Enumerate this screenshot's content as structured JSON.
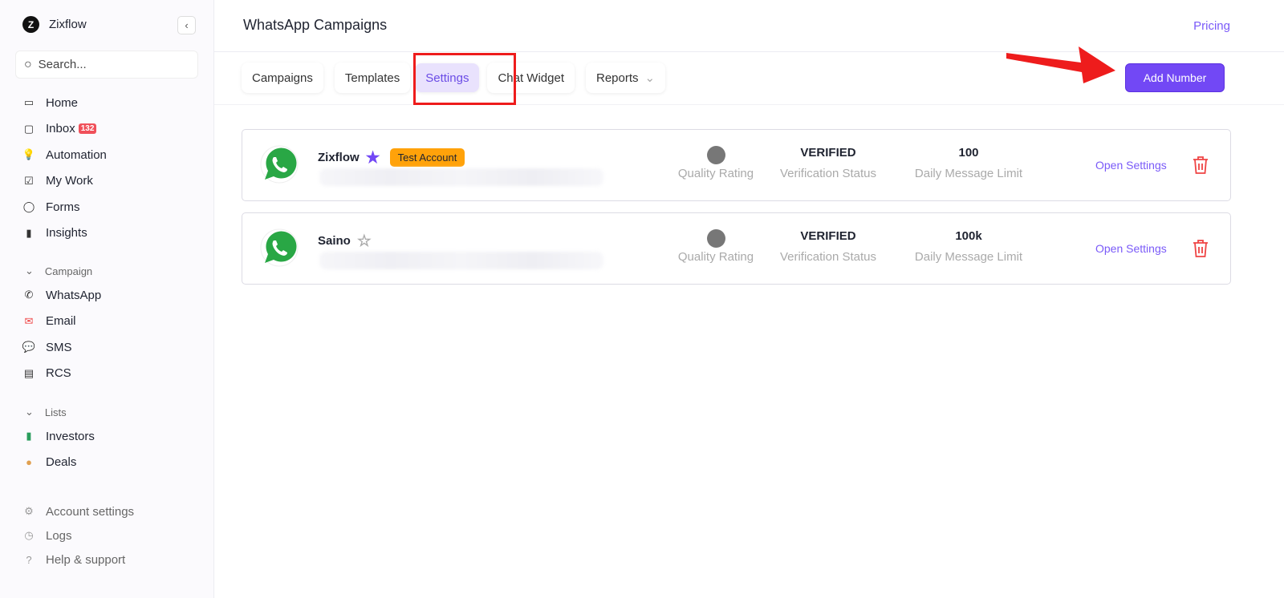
{
  "sidebar": {
    "brand": "Zixflow",
    "search_placeholder": "Search...",
    "items": [
      {
        "label": "Home",
        "icon": "laptop-icon"
      },
      {
        "label": "Inbox",
        "icon": "inbox-icon",
        "badge": "132"
      },
      {
        "label": "Automation",
        "icon": "lightbulb-icon"
      },
      {
        "label": "My Work",
        "icon": "checkbox-icon"
      },
      {
        "label": "Forms",
        "icon": "chat-bubble-icon"
      },
      {
        "label": "Insights",
        "icon": "bar-chart-icon"
      }
    ],
    "campaign_section": "Campaign",
    "campaign_items": [
      {
        "label": "WhatsApp",
        "icon": "whatsapp-icon"
      },
      {
        "label": "Email",
        "icon": "email-icon"
      },
      {
        "label": "SMS",
        "icon": "sms-icon"
      },
      {
        "label": "RCS",
        "icon": "rcs-icon"
      }
    ],
    "lists_section": "Lists",
    "list_items": [
      {
        "label": "Investors",
        "icon": "money-icon"
      },
      {
        "label": "Deals",
        "icon": "money-bag-icon"
      }
    ],
    "bottom_items": [
      {
        "label": "Account settings",
        "icon": "gear-icon"
      },
      {
        "label": "Logs",
        "icon": "clock-icon"
      },
      {
        "label": "Help & support",
        "icon": "help-icon"
      }
    ]
  },
  "header": {
    "title": "WhatsApp Campaigns",
    "pricing": "Pricing"
  },
  "tabs": [
    {
      "label": "Campaigns"
    },
    {
      "label": "Templates"
    },
    {
      "label": "Settings",
      "active": true
    },
    {
      "label": "Chat Widget"
    },
    {
      "label": "Reports"
    }
  ],
  "add_number": "Add Number",
  "accounts": [
    {
      "name": "Zixflow",
      "starred": true,
      "tag": "Test Account",
      "verification": "VERIFIED",
      "limit": "100"
    },
    {
      "name": "Saino",
      "starred": false,
      "tag": "",
      "verification": "VERIFIED",
      "limit": "100k"
    }
  ],
  "labels": {
    "quality": "Quality Rating",
    "verification": "Verification Status",
    "limit": "Daily Message Limit",
    "open": "Open Settings"
  },
  "colors": {
    "accent": "#7248f5",
    "tag": "#ffa20a",
    "annotation": "#ee1c1c",
    "delete": "#ef4444"
  }
}
